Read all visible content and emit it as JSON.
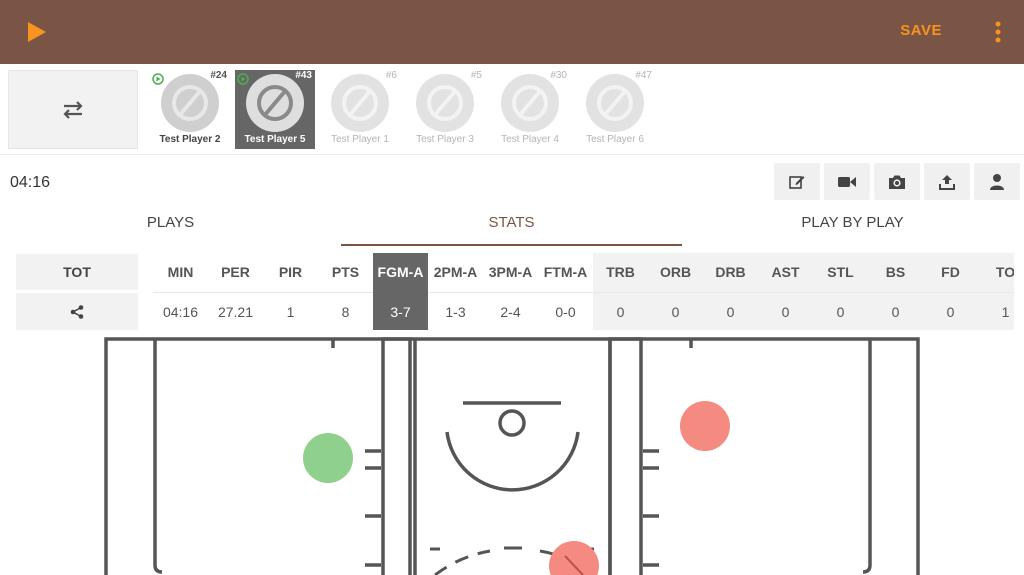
{
  "toolbar": {
    "save_label": "SAVE",
    "accent": "#f7931e",
    "bar_color": "#7a5545"
  },
  "players": [
    {
      "number": "#24",
      "name": "Test Player 2",
      "state": "oncourt"
    },
    {
      "number": "#43",
      "name": "Test Player 5",
      "state": "selected"
    },
    {
      "number": "#6",
      "name": "Test Player 1",
      "state": "bench"
    },
    {
      "number": "#5",
      "name": "Test Player 3",
      "state": "bench"
    },
    {
      "number": "#30",
      "name": "Test Player 4",
      "state": "bench"
    },
    {
      "number": "#47",
      "name": "Test Player 6",
      "state": "bench"
    }
  ],
  "game_clock": "04:16",
  "tools": [
    "edit-icon",
    "video-camera-icon",
    "camera-icon",
    "upload-icon",
    "user-icon"
  ],
  "tabs": [
    {
      "label": "PLAYS",
      "active": false
    },
    {
      "label": "STATS",
      "active": true
    },
    {
      "label": "PLAY BY PLAY",
      "active": false
    }
  ],
  "stats": {
    "row_label": "TOT",
    "headers": [
      "MIN",
      "PER",
      "PIR",
      "PTS",
      "FGM-A",
      "2PM-A",
      "3PM-A",
      "FTM-A",
      "TRB",
      "ORB",
      "DRB",
      "AST",
      "STL",
      "BS",
      "FD",
      "TO"
    ],
    "values": [
      "04:16",
      "27.21",
      "1",
      "8",
      "3-7",
      "1-3",
      "2-4",
      "0-0",
      "0",
      "0",
      "0",
      "0",
      "0",
      "0",
      "0",
      "1"
    ],
    "highlighted": "FGM-A"
  },
  "shot_chart": {
    "made_color": "#8fd08c",
    "missed_color": "#f48a80",
    "shots": [
      {
        "result": "made"
      },
      {
        "result": "missed"
      },
      {
        "result": "missed"
      }
    ]
  }
}
